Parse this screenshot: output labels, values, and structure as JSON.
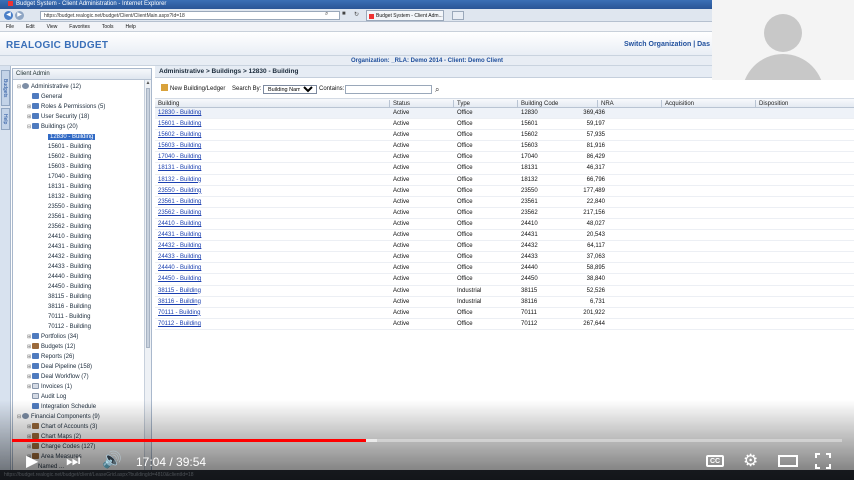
{
  "browser": {
    "window_title": "Budget System - Client Administration - Internet Explorer",
    "url": "https://budget.realogic.net/budget/Client/ClientMain.aspx?Id=18",
    "tab_label": "Budget System - Client Adm...",
    "menu": [
      "File",
      "Edit",
      "View",
      "Favorites",
      "Tools",
      "Help"
    ]
  },
  "app": {
    "brand": "REALOGIC BUDGET",
    "switch_org": "Switch Organization | Das",
    "org_line": "Organization: _RLA: Demo 2014 - Client: Demo Client",
    "side_tabs": [
      "Budgets",
      "Help"
    ]
  },
  "tree": {
    "header": "Client Admin",
    "nodes": [
      {
        "label": "Administrative (12)",
        "toggle": "⊟",
        "icon": "gear",
        "indent": 0
      },
      {
        "label": "General",
        "toggle": "",
        "icon": "folder",
        "indent": 1
      },
      {
        "label": "Roles & Permissions (5)",
        "toggle": "⊞",
        "icon": "folder",
        "indent": 1
      },
      {
        "label": "User Security (18)",
        "toggle": "⊞",
        "icon": "folder",
        "indent": 1
      },
      {
        "label": "Buildings (20)",
        "toggle": "⊟",
        "icon": "folder",
        "indent": 1
      },
      {
        "label": "12830 - Building",
        "toggle": "",
        "icon": "",
        "indent": 2,
        "selected": true
      },
      {
        "label": "15601 - Building",
        "toggle": "",
        "icon": "",
        "indent": 2
      },
      {
        "label": "15602 - Building",
        "toggle": "",
        "icon": "",
        "indent": 2
      },
      {
        "label": "15603 - Building",
        "toggle": "",
        "icon": "",
        "indent": 2
      },
      {
        "label": "17040 - Building",
        "toggle": "",
        "icon": "",
        "indent": 2
      },
      {
        "label": "18131 - Building",
        "toggle": "",
        "icon": "",
        "indent": 2
      },
      {
        "label": "18132 - Building",
        "toggle": "",
        "icon": "",
        "indent": 2
      },
      {
        "label": "23550 - Building",
        "toggle": "",
        "icon": "",
        "indent": 2
      },
      {
        "label": "23561 - Building",
        "toggle": "",
        "icon": "",
        "indent": 2
      },
      {
        "label": "23562 - Building",
        "toggle": "",
        "icon": "",
        "indent": 2
      },
      {
        "label": "24410 - Building",
        "toggle": "",
        "icon": "",
        "indent": 2
      },
      {
        "label": "24431 - Building",
        "toggle": "",
        "icon": "",
        "indent": 2
      },
      {
        "label": "24432 - Building",
        "toggle": "",
        "icon": "",
        "indent": 2
      },
      {
        "label": "24433 - Building",
        "toggle": "",
        "icon": "",
        "indent": 2
      },
      {
        "label": "24440 - Building",
        "toggle": "",
        "icon": "",
        "indent": 2
      },
      {
        "label": "24450 - Building",
        "toggle": "",
        "icon": "",
        "indent": 2
      },
      {
        "label": "38115 - Building",
        "toggle": "",
        "icon": "",
        "indent": 2
      },
      {
        "label": "38116 - Building",
        "toggle": "",
        "icon": "",
        "indent": 2
      },
      {
        "label": "70111 - Building",
        "toggle": "",
        "icon": "",
        "indent": 2
      },
      {
        "label": "70112 - Building",
        "toggle": "",
        "icon": "",
        "indent": 2
      },
      {
        "label": "Portfolios (34)",
        "toggle": "⊞",
        "icon": "folder",
        "indent": 1
      },
      {
        "label": "Budgets (12)",
        "toggle": "⊞",
        "icon": "brown",
        "indent": 1
      },
      {
        "label": "Reports (26)",
        "toggle": "⊞",
        "icon": "folder",
        "indent": 1
      },
      {
        "label": "Deal Pipeline (158)",
        "toggle": "⊞",
        "icon": "folder",
        "indent": 1
      },
      {
        "label": "Deal Workflow (7)",
        "toggle": "⊞",
        "icon": "folder",
        "indent": 1
      },
      {
        "label": "Invoices (1)",
        "toggle": "⊞",
        "icon": "doc",
        "indent": 1
      },
      {
        "label": "Audit Log",
        "toggle": "",
        "icon": "doc",
        "indent": 1
      },
      {
        "label": "Integration Schedule",
        "toggle": "",
        "icon": "folder",
        "indent": 1
      },
      {
        "label": "Financial Components (9)",
        "toggle": "⊟",
        "icon": "gear",
        "indent": 0
      },
      {
        "label": "Chart of Accounts (3)",
        "toggle": "⊞",
        "icon": "brown",
        "indent": 1
      },
      {
        "label": "Chart Maps (2)",
        "toggle": "⊞",
        "icon": "brown",
        "indent": 1
      },
      {
        "label": "Charge Codes (127)",
        "toggle": "⊞",
        "icon": "brown",
        "indent": 1
      },
      {
        "label": "Area Measures",
        "toggle": "⊞",
        "icon": "brown",
        "indent": 1
      },
      {
        "label": "Named ...",
        "toggle": "",
        "icon": "",
        "indent": 1
      }
    ]
  },
  "main": {
    "breadcrumb": "Administrative > Buildings > 12830 - Building",
    "new_button": "New Building/Ledger",
    "search_by_label": "Search By:",
    "search_by_value": "Building Name",
    "contains_label": "Contains:",
    "search_value": "",
    "columns": [
      "Building",
      "Status",
      "Type",
      "Building Code",
      "NRA",
      "Acquisition",
      "Disposition"
    ],
    "rows": [
      [
        "12830 - Building",
        "Active",
        "Office",
        "12830",
        "369,436"
      ],
      [
        "15601 - Building",
        "Active",
        "Office",
        "15601",
        "59,197"
      ],
      [
        "15602 - Building",
        "Active",
        "Office",
        "15602",
        "57,935"
      ],
      [
        "15603 - Building",
        "Active",
        "Office",
        "15603",
        "81,916"
      ],
      [
        "17040 - Building",
        "Active",
        "Office",
        "17040",
        "86,429"
      ],
      [
        "18131 - Building",
        "Active",
        "Office",
        "18131",
        "46,317"
      ],
      [
        "18132 - Building",
        "Active",
        "Office",
        "18132",
        "66,796"
      ],
      [
        "23550 - Building",
        "Active",
        "Office",
        "23550",
        "177,489"
      ],
      [
        "23561 - Building",
        "Active",
        "Office",
        "23561",
        "22,840"
      ],
      [
        "23562 - Building",
        "Active",
        "Office",
        "23562",
        "217,156"
      ],
      [
        "24410 - Building",
        "Active",
        "Office",
        "24410",
        "48,027"
      ],
      [
        "24431 - Building",
        "Active",
        "Office",
        "24431",
        "20,543"
      ],
      [
        "24432 - Building",
        "Active",
        "Office",
        "24432",
        "64,117"
      ],
      [
        "24433 - Building",
        "Active",
        "Office",
        "24433",
        "37,063"
      ],
      [
        "24440 - Building",
        "Active",
        "Office",
        "24440",
        "58,895"
      ],
      [
        "24450 - Building",
        "Active",
        "Office",
        "24450",
        "38,840"
      ],
      [
        "38115 - Building",
        "Active",
        "Industrial",
        "38115",
        "52,526"
      ],
      [
        "38116 - Building",
        "Active",
        "Industrial",
        "38116",
        "6,731"
      ],
      [
        "70111 - Building",
        "Active",
        "Office",
        "70111",
        "201,922"
      ],
      [
        "70112 - Building",
        "Active",
        "Office",
        "70112",
        "267,644"
      ]
    ]
  },
  "status_bar": "https://budget.realogic.net/budget/client/LeaseGrid.aspx?buildingId=4810&clientId=18",
  "video": {
    "time": "17:04 / 39:54",
    "played_fraction": 0.427,
    "buffered_fraction": 0.44,
    "cc_label": "CC",
    "accent": "#ff0000"
  },
  "icons": [
    "back-icon",
    "forward-icon",
    "search-icon",
    "play-icon",
    "next-icon",
    "volume-icon",
    "settings-icon",
    "fullscreen-icon"
  ]
}
